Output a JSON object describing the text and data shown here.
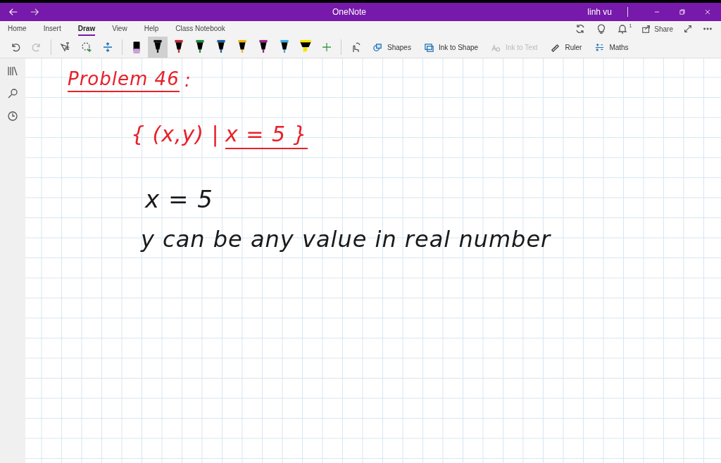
{
  "window": {
    "title": "OneNote",
    "user": "linh vu"
  },
  "tabs": [
    {
      "label": "Home",
      "selected": false
    },
    {
      "label": "Insert",
      "selected": false
    },
    {
      "label": "Draw",
      "selected": true
    },
    {
      "label": "View",
      "selected": false
    },
    {
      "label": "Help",
      "selected": false
    },
    {
      "label": "Class Notebook",
      "selected": false
    }
  ],
  "top_actions": {
    "notification_count": "1",
    "share_label": "Share"
  },
  "pens": [
    {
      "kind": "eraser",
      "color": "#c9a0dc",
      "selected": false
    },
    {
      "kind": "pen",
      "color": "#111111",
      "selected": true
    },
    {
      "kind": "pen",
      "color": "#d0202a",
      "selected": false
    },
    {
      "kind": "pen",
      "color": "#1a8a3a",
      "selected": false
    },
    {
      "kind": "pen",
      "color": "#1a5fa0",
      "selected": false
    },
    {
      "kind": "pen",
      "color": "#f0b400",
      "selected": false
    },
    {
      "kind": "pen",
      "color": "#a0208a",
      "selected": false
    },
    {
      "kind": "pen",
      "color": "#30b0e0",
      "selected": false
    },
    {
      "kind": "highlighter",
      "color": "#f5e600",
      "selected": false
    }
  ],
  "tools": [
    {
      "label": "Shapes",
      "disabled": false
    },
    {
      "label": "Ink to Shape",
      "disabled": false
    },
    {
      "label": "Ink to Text",
      "disabled": true
    },
    {
      "label": "Ruler",
      "disabled": false
    },
    {
      "label": "Maths",
      "disabled": false
    }
  ],
  "ink": [
    {
      "text": "Problem 46",
      "color": "#e8202a",
      "underlined": true
    },
    {
      "text": ":",
      "color": "#e8202a",
      "underlined": false
    },
    {
      "text": "{ (x,y) |",
      "color": "#e8202a",
      "underlined": false
    },
    {
      "text": "x = 5 }",
      "color": "#e8202a",
      "underlined": true
    },
    {
      "text": "x = 5",
      "color": "#1a1a1a",
      "underlined": false
    },
    {
      "text": "y can be any value in real number",
      "color": "#1a1a1a",
      "underlined": false
    }
  ]
}
